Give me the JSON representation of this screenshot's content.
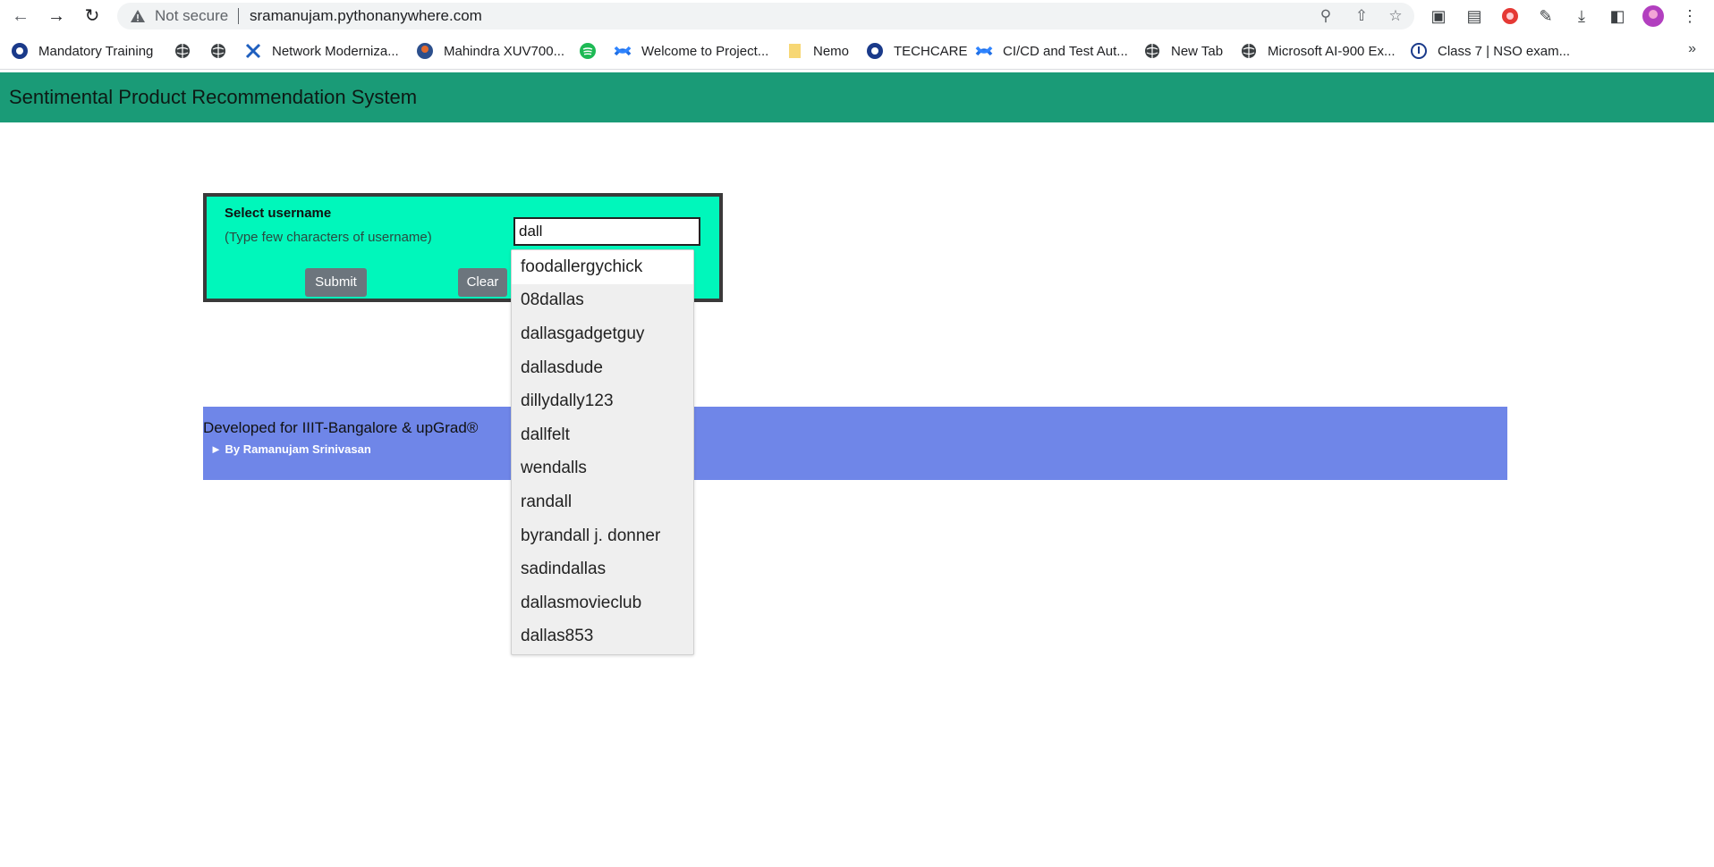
{
  "browser": {
    "security_label": "Not secure",
    "url": "sramanujam.pythonanywhere.com",
    "bookmarks": [
      {
        "label": "Mandatory Training",
        "icon": "circle-logo-icon"
      },
      {
        "label": "",
        "icon": "globe-icon"
      },
      {
        "label": "",
        "icon": "globe-icon"
      },
      {
        "label": "Network Moderniza...",
        "icon": "x-logo-icon"
      },
      {
        "label": "Mahindra XUV700...",
        "icon": "brand-logo-icon"
      },
      {
        "label": "",
        "icon": "spotify-icon"
      },
      {
        "label": "Welcome to Project...",
        "icon": "confluence-icon"
      },
      {
        "label": "Nemo",
        "icon": "note-icon"
      },
      {
        "label": "TECHCARE",
        "icon": "circle-logo-icon"
      },
      {
        "label": "CI/CD and Test Aut...",
        "icon": "confluence-icon"
      },
      {
        "label": "New Tab",
        "icon": "globe-icon"
      },
      {
        "label": "Microsoft AI-900 Ex...",
        "icon": "globe-icon"
      },
      {
        "label": "Class 7 | NSO exam...",
        "icon": "info-circle-icon"
      }
    ],
    "more_label": "»"
  },
  "app": {
    "title": "Sentimental Product Recommendation System"
  },
  "form": {
    "select_label": "Select username",
    "hint": "(Type few characters of username)",
    "username_value": "dall",
    "submit_label": "Submit",
    "clear_label": "Clear"
  },
  "suggestions": [
    "foodallergychick",
    "08dallas",
    "dallasgadgetguy",
    "dallasdude",
    "dillydally123",
    "dallfelt",
    "wendalls",
    "randall",
    "byrandall j. donner",
    "sadindallas",
    "dallasmovieclub",
    "dallas853"
  ],
  "footer": {
    "main": "Developed for IIIT-Bangalore & upGrad®",
    "sub": "► By Ramanujam Srinivasan"
  },
  "colors": {
    "header": "#1a9b77",
    "panel": "#00f7bb",
    "footer": "#6f86e8",
    "button": "#6c757d"
  }
}
